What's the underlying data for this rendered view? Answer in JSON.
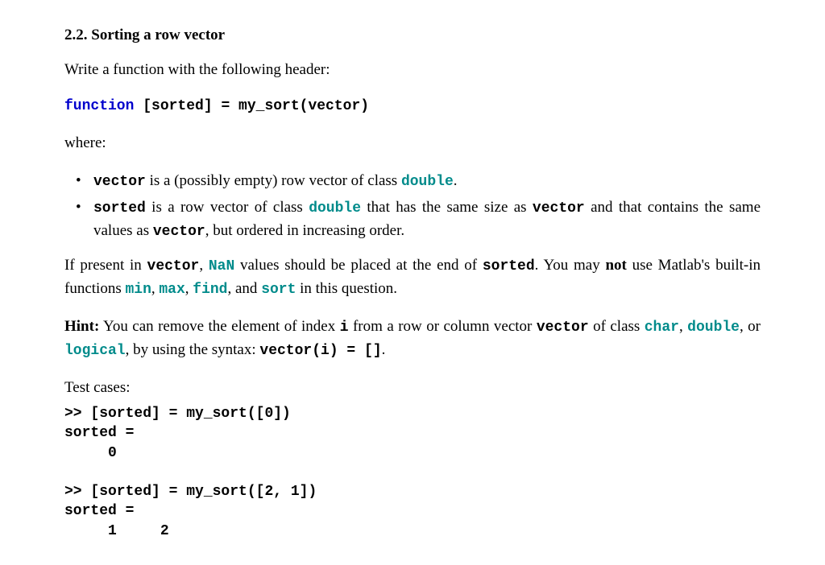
{
  "heading": {
    "number": "2.2.",
    "title": "Sorting a row vector"
  },
  "intro": "Write a function with the following header:",
  "func_sig": {
    "kw": "function",
    "rest": " [sorted] = my_sort(vector)"
  },
  "where_label": "where:",
  "bullets": {
    "b1": {
      "code1": "vector",
      "t1": " is a (possibly empty) row vector of class ",
      "code2": "double",
      "t2": "."
    },
    "b2": {
      "code1": "sorted",
      "t1": " is a row vector of class ",
      "code2": "double",
      "t2": " that has the same size as ",
      "code3": "vector",
      "t3": " and that contains the same values as ",
      "code4": "vector",
      "t4": ", but ordered in increasing order."
    }
  },
  "nan_para": {
    "t1": "If present in ",
    "c1": "vector",
    "t2": ", ",
    "c2": "NaN",
    "t3": " values should be placed at the end of ",
    "c3": "sorted",
    "t4": ". You may ",
    "bold1": "not",
    "t5": " use Matlab's built-in functions ",
    "c4": "min",
    "t6": ", ",
    "c5": "max",
    "t7": ", ",
    "c6": "find",
    "t8": ", and ",
    "c7": "sort",
    "t9": " in this question."
  },
  "hint": {
    "label": "Hint:",
    "t1": " You can remove the element of index ",
    "c1": "i",
    "t2": " from a row or column vector ",
    "c2": "vector",
    "t3": " of class ",
    "c3": "char",
    "t4": ", ",
    "c4": "double",
    "t5": ", or ",
    "c5": "logical",
    "t6": ", by using the syntax: ",
    "c6": "vector(i) = []",
    "t7": "."
  },
  "testcases_label": "Test cases:",
  "testcases": ">> [sorted] = my_sort([0])\nsorted =\n     0\n\n>> [sorted] = my_sort([2, 1])\nsorted =\n     1     2"
}
